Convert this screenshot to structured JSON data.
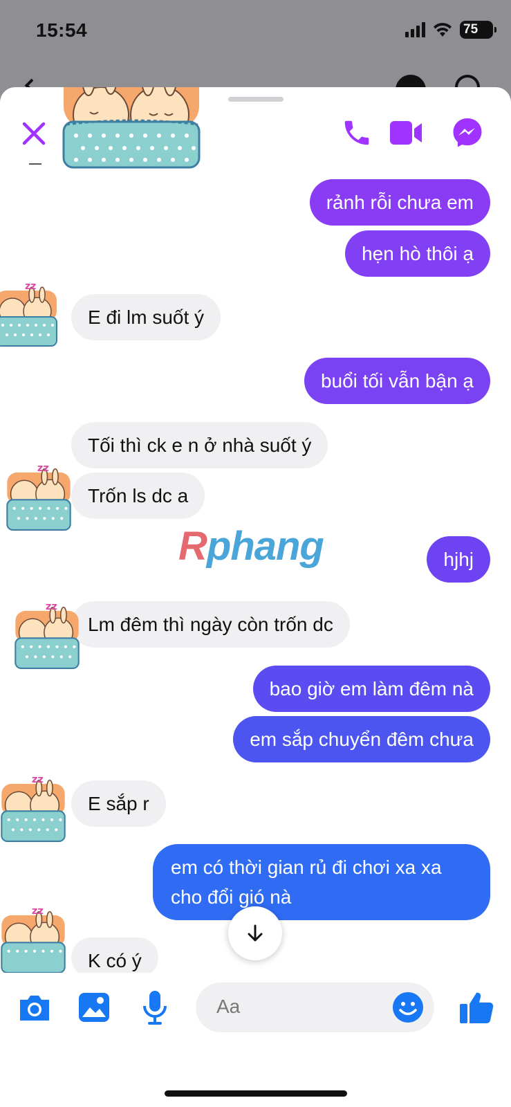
{
  "status_bar": {
    "time": "15:54",
    "battery": "75"
  },
  "header": {
    "close_icon": "close-icon",
    "actions": [
      "phone-icon",
      "video-icon",
      "messenger-icon"
    ]
  },
  "colors": {
    "accent": "#a033ff",
    "out_purple": "#8a3cf5",
    "out_violet": "#6d43f2",
    "out_blue": "#3d5df0",
    "out_blue2": "#2f6cf3",
    "incoming": "#f0f0f2"
  },
  "messages": [
    {
      "dir": "out",
      "text": "rảnh rỗi chưa em"
    },
    {
      "dir": "out",
      "text": "hẹn hò thôi ạ"
    },
    {
      "dir": "in",
      "text": "E đi lm suốt ý"
    },
    {
      "dir": "out",
      "text": "buổi tối vẫn bận ạ"
    },
    {
      "dir": "in",
      "text": "Tối thì ck e n ở nhà suốt ý"
    },
    {
      "dir": "in",
      "text": "Trốn ls dc a"
    },
    {
      "dir": "out",
      "text": "hjhj"
    },
    {
      "dir": "in",
      "text": "Lm đêm thì ngày còn trốn dc"
    },
    {
      "dir": "out",
      "text": "bao giờ em làm đêm nà"
    },
    {
      "dir": "out",
      "text": "em sắp chuyển đêm chưa"
    },
    {
      "dir": "in",
      "text": "E sắp r"
    },
    {
      "dir": "out",
      "text": "em có thời gian rủ đi chơi xa xa cho đổi gió nà"
    },
    {
      "dir": "in",
      "text": "K có ý"
    }
  ],
  "watermark": {
    "first": "R",
    "rest": "phang"
  },
  "composer": {
    "placeholder": "Aa",
    "icons": [
      "camera-icon",
      "image-icon",
      "microphone-icon",
      "emoji-icon",
      "thumbs-up-icon"
    ]
  },
  "scroll_icon": "arrow-down-icon"
}
